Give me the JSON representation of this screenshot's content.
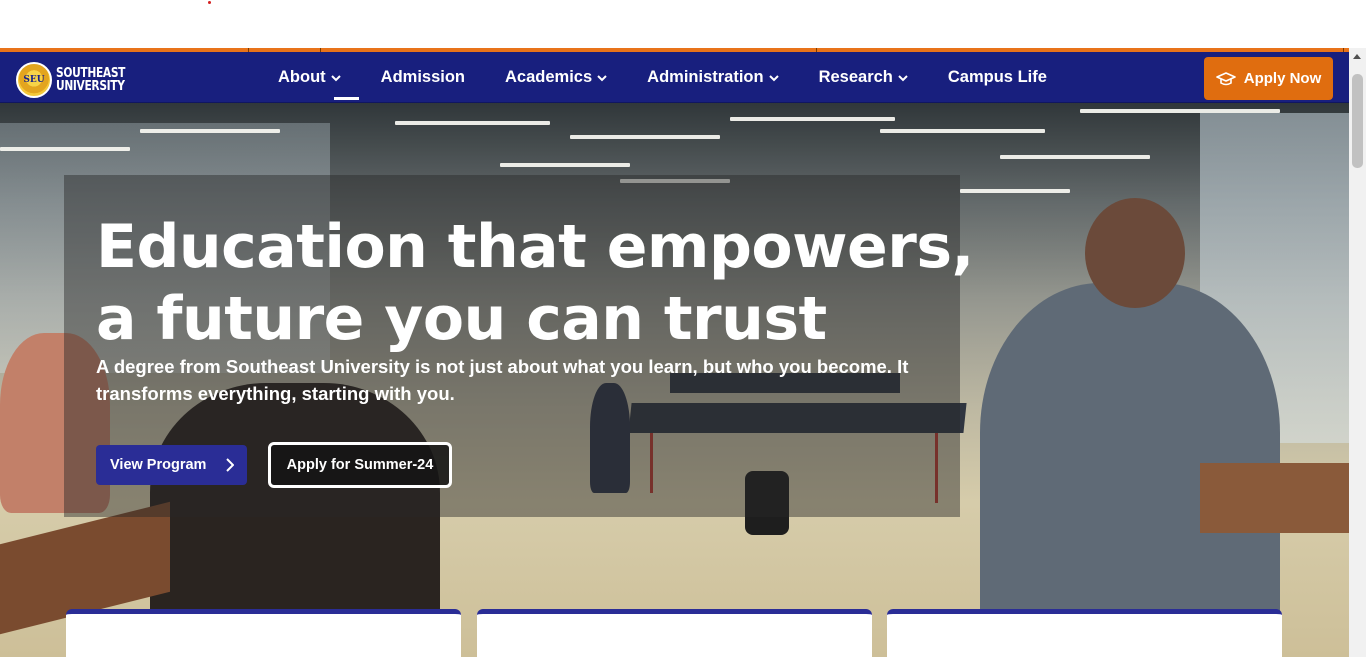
{
  "brand": {
    "logo_line1": "SOUTHEAST",
    "logo_line2": "UNIVERSITY",
    "seal_letters": "SEU",
    "colors": {
      "navy": "#181f7e",
      "orange": "#e06d0f",
      "button_blue": "#2a2d96"
    }
  },
  "nav": {
    "items": [
      {
        "label": "About",
        "dropdown": true,
        "active": true
      },
      {
        "label": "Admission",
        "dropdown": false,
        "active": false
      },
      {
        "label": "Academics",
        "dropdown": true,
        "active": false
      },
      {
        "label": "Administration",
        "dropdown": true,
        "active": false
      },
      {
        "label": "Research",
        "dropdown": true,
        "active": false
      },
      {
        "label": "Campus Life",
        "dropdown": false,
        "active": false
      }
    ],
    "apply_now_label": "Apply Now",
    "apply_icon": "graduation-cap-icon"
  },
  "hero": {
    "title_line1": "Education that empowers,",
    "title_line2": "a future you can trust",
    "subtitle": "A degree from Southeast University is not just about what you learn, but who you become. It transforms everything, starting with you.",
    "primary_button": "View Program",
    "secondary_button": "Apply for Summer-24"
  }
}
